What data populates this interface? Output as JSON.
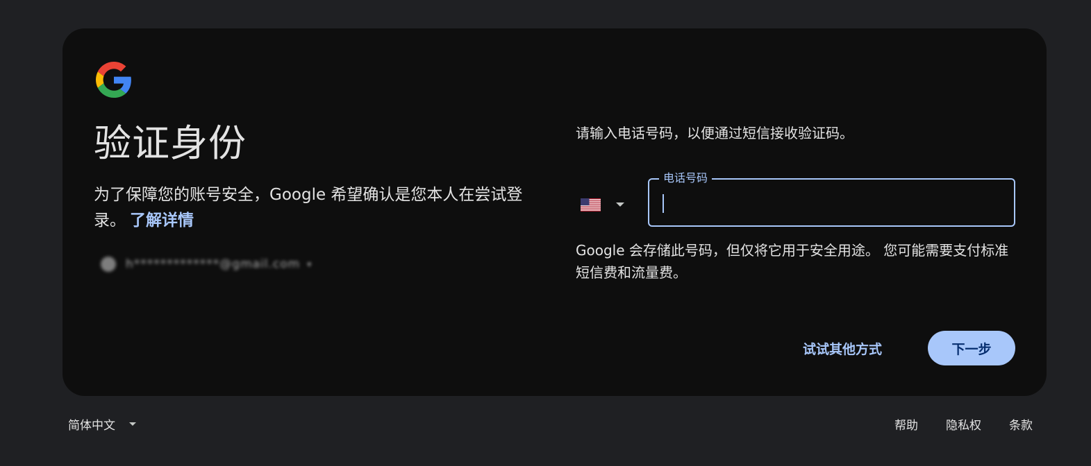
{
  "card": {
    "title": "验证身份",
    "description": "为了保障您的账号安全，Google 希望确认是您本人在尝试登录。",
    "learn_more": "了解详情",
    "account_email": "h*************@gmail.com"
  },
  "phone": {
    "prompt": "请输入电话号码，以便通过短信接收验证码。",
    "country_icon": "us-flag-icon",
    "field_label": "电话号码",
    "field_value": "",
    "note": "Google 会存储此号码，但仅将它用于安全用途。 您可能需要支付标准短信费和流量费。"
  },
  "actions": {
    "try_other": "试试其他方式",
    "next": "下一步"
  },
  "footer": {
    "language": "简体中文",
    "links": [
      "帮助",
      "隐私权",
      "条款"
    ]
  },
  "colors": {
    "page_bg": "#1f2023",
    "card_bg": "#0e0e0e",
    "accent": "#a8c7fa",
    "button_text": "#062e6f"
  }
}
